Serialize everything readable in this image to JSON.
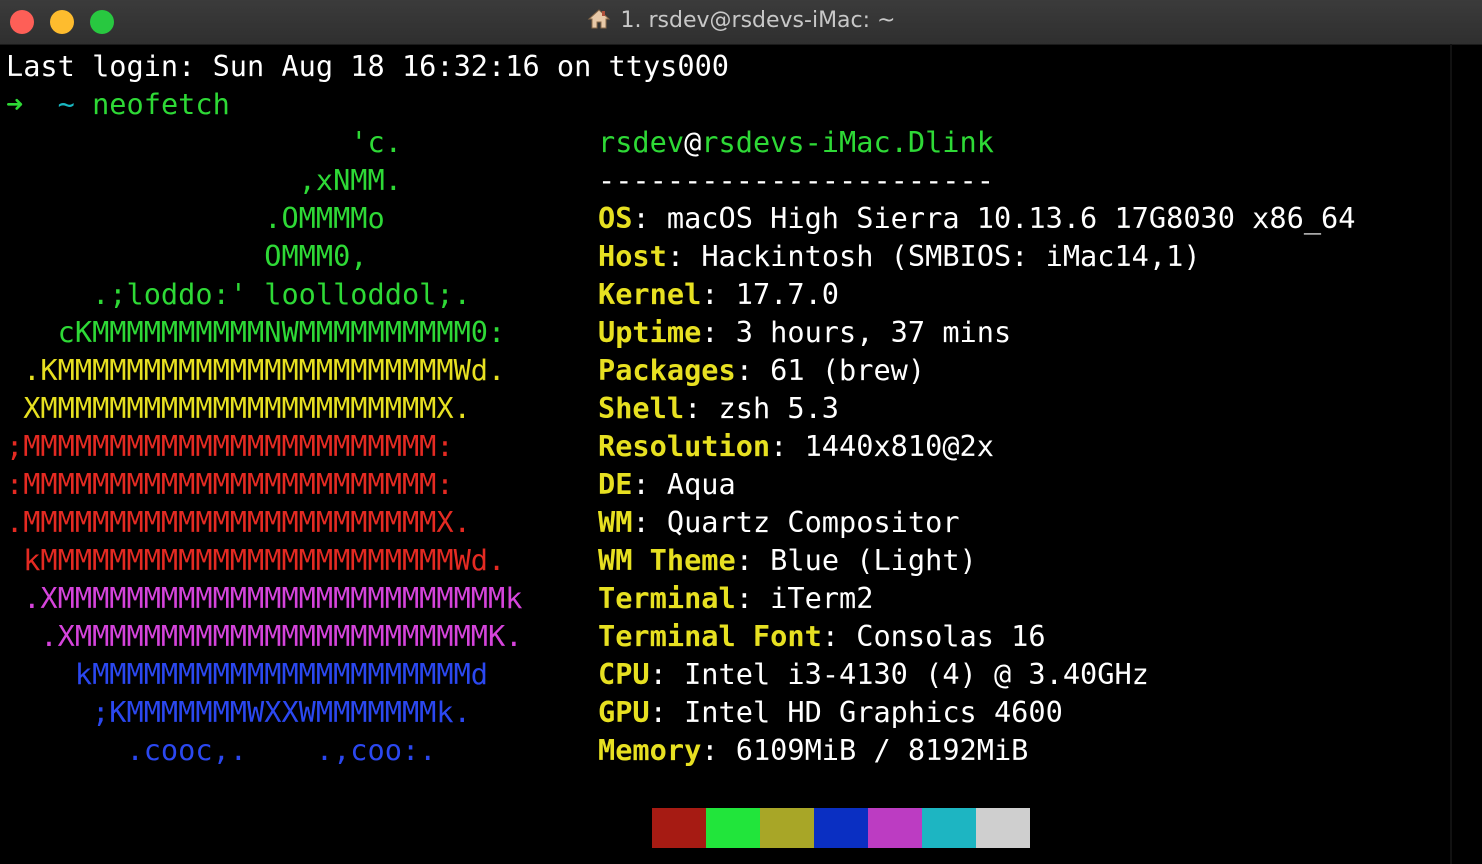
{
  "window": {
    "title": "1. rsdev@rsdevs-iMac: ~"
  },
  "terminal": {
    "last_login": "Last login: Sun Aug 18 16:32:16 on ttys000",
    "prompt_arrow": "➜",
    "prompt_tilde": "~",
    "command": "neofetch",
    "ascii_art": [
      {
        "text": "                    'c.",
        "color": "green"
      },
      {
        "text": "                 ,xNMM.",
        "color": "green"
      },
      {
        "text": "               .OMMMMo",
        "color": "green"
      },
      {
        "text": "               OMMM0,",
        "color": "green"
      },
      {
        "text": "     .;loddo:' loolloddol;.",
        "color": "green"
      },
      {
        "text": "   cKMMMMMMMMMMNWMMMMMMMMMM0:",
        "color": "green"
      },
      {
        "text": " .KMMMMMMMMMMMMMMMMMMMMMMMWd.",
        "color": "yellow"
      },
      {
        "text": " XMMMMMMMMMMMMMMMMMMMMMMMX.",
        "color": "yellow"
      },
      {
        "text": ";MMMMMMMMMMMMMMMMMMMMMMMM:",
        "color": "red"
      },
      {
        "text": ":MMMMMMMMMMMMMMMMMMMMMMMM:",
        "color": "red"
      },
      {
        "text": ".MMMMMMMMMMMMMMMMMMMMMMMMX.",
        "color": "red"
      },
      {
        "text": " kMMMMMMMMMMMMMMMMMMMMMMMMWd.",
        "color": "red"
      },
      {
        "text": " .XMMMMMMMMMMMMMMMMMMMMMMMMMMk",
        "color": "purple"
      },
      {
        "text": "  .XMMMMMMMMMMMMMMMMMMMMMMMMK.",
        "color": "purple"
      },
      {
        "text": "    kMMMMMMMMMMMMMMMMMMMMMMd",
        "color": "blue"
      },
      {
        "text": "     ;KMMMMMMMWXXWMMMMMMMk.",
        "color": "blue"
      },
      {
        "text": "       .cooc,.    .,coo:.",
        "color": "blue"
      }
    ],
    "info_header": {
      "user": "rsdev",
      "at": "@",
      "host": "rsdevs-iMac.Dlink"
    },
    "info_separator": "-----------------------",
    "info": [
      {
        "key": "OS",
        "value": "macOS High Sierra 10.13.6 17G8030 x86_64"
      },
      {
        "key": "Host",
        "value": "Hackintosh (SMBIOS: iMac14,1)"
      },
      {
        "key": "Kernel",
        "value": "17.7.0"
      },
      {
        "key": "Uptime",
        "value": "3 hours, 37 mins"
      },
      {
        "key": "Packages",
        "value": "61 (brew)"
      },
      {
        "key": "Shell",
        "value": "zsh 5.3"
      },
      {
        "key": "Resolution",
        "value": "1440x810@2x"
      },
      {
        "key": "DE",
        "value": "Aqua"
      },
      {
        "key": "WM",
        "value": "Quartz Compositor"
      },
      {
        "key": "WM Theme",
        "value": "Blue (Light)"
      },
      {
        "key": "Terminal",
        "value": "iTerm2"
      },
      {
        "key": "Terminal Font",
        "value": "Consolas 16"
      },
      {
        "key": "CPU",
        "value": "Intel i3-4130 (4) @ 3.40GHz"
      },
      {
        "key": "GPU",
        "value": "Intel HD Graphics 4600"
      },
      {
        "key": "Memory",
        "value": "6109MiB / 8192MiB"
      }
    ],
    "color_swatches": [
      "#a61b13",
      "#21e53b",
      "#a8a627",
      "#0a2fc2",
      "#bc3cc2",
      "#1db5c2",
      "#cfcfcf"
    ]
  },
  "icons": {
    "title_icon": "home-icon"
  }
}
